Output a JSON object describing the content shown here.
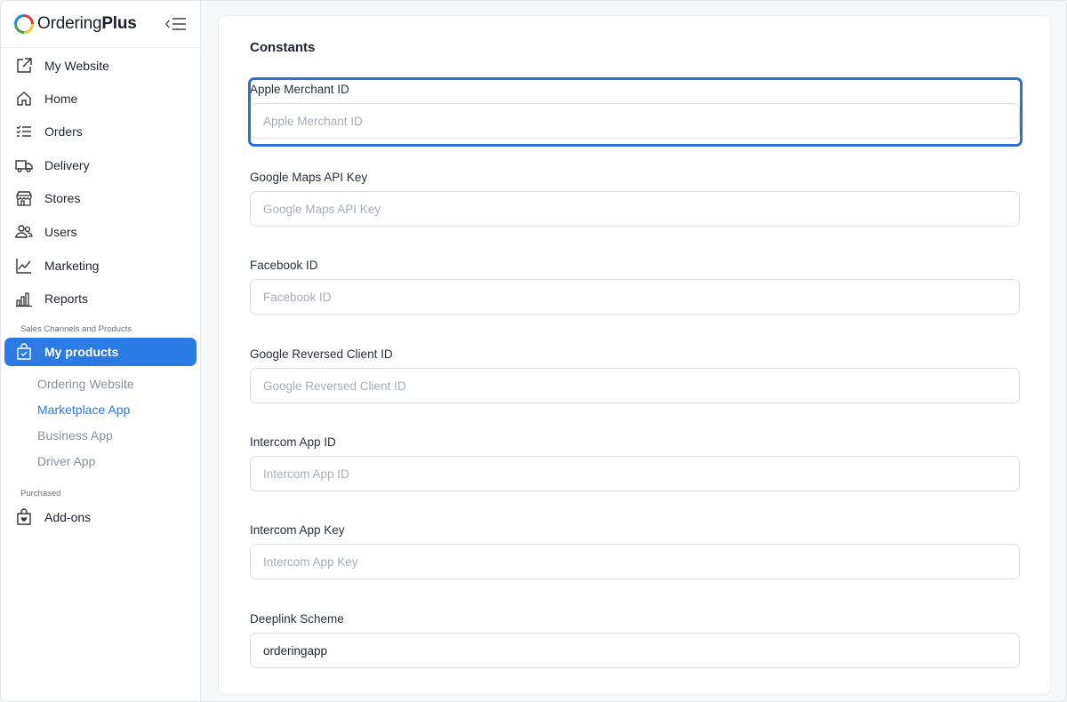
{
  "brand": {
    "name_regular": "Ordering",
    "name_bold": "Plus"
  },
  "sidebar": {
    "items": [
      {
        "label": "My Website",
        "icon": "external-link-icon"
      },
      {
        "label": "Home",
        "icon": "home-icon"
      },
      {
        "label": "Orders",
        "icon": "list-check-icon"
      },
      {
        "label": "Delivery",
        "icon": "truck-icon"
      },
      {
        "label": "Stores",
        "icon": "shop-icon"
      },
      {
        "label": "Users",
        "icon": "people-icon"
      },
      {
        "label": "Marketing",
        "icon": "graph-up-icon"
      },
      {
        "label": "Reports",
        "icon": "bar-chart-icon"
      }
    ],
    "section_sales": "Sales Channels and Products",
    "products": {
      "label": "My products",
      "icon": "bag-check-icon"
    },
    "sub_items": [
      "Ordering Website",
      "Marketplace App",
      "Business App",
      "Driver App"
    ],
    "current_sub": "Marketplace App",
    "section_purchased": "Purchased",
    "addons": {
      "label": "Add-ons",
      "icon": "bag-heart-icon"
    }
  },
  "main": {
    "title": "Constants",
    "fields": [
      {
        "label": "Apple Merchant ID",
        "placeholder": "Apple Merchant ID",
        "value": ""
      },
      {
        "label": "Google Maps API Key",
        "placeholder": "Google Maps API Key",
        "value": ""
      },
      {
        "label": "Facebook ID",
        "placeholder": "Facebook ID",
        "value": ""
      },
      {
        "label": "Google Reversed Client ID",
        "placeholder": "Google Reversed Client ID",
        "value": ""
      },
      {
        "label": "Intercom App ID",
        "placeholder": "Intercom App ID",
        "value": ""
      },
      {
        "label": "Intercom App Key",
        "placeholder": "Intercom App Key",
        "value": ""
      },
      {
        "label": "Deeplink Scheme",
        "placeholder": "",
        "value": "orderingapp"
      }
    ]
  },
  "colors": {
    "accent": "#2c7be5",
    "focus": "#2f6fd6"
  }
}
